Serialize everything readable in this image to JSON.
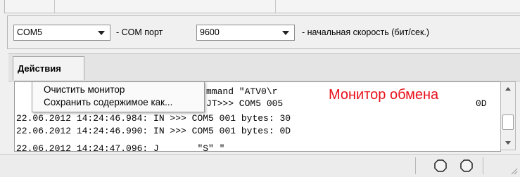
{
  "settings": {
    "port_value": "COM5",
    "port_label": "- COM порт",
    "speed_value": "9600",
    "speed_label": "- начальная скорость (бит/сек.)"
  },
  "tab": {
    "label": "Действия"
  },
  "context_menu": {
    "items": [
      "Очистить монитор",
      "Сохранить содержимое как..."
    ]
  },
  "monitor": {
    "lines": [
      "mmand \"ATV0\\r",
      "JT>>> COM5 005",
      "22.06.2012 14:24:46.984: IN >>> COM5 001 bytes: 30",
      "22.06.2012 14:24:46.990: IN >>> COM5 001 bytes: 0D",
      "22.06.2012 14:24:47.096: J       \"S\" \""
    ],
    "overflow_fragment": "0D"
  },
  "annotation": {
    "text": "Монитор обмена",
    "color": "#e8101a"
  },
  "icons": {
    "combo_arrow": "chevron-down-icon",
    "status": [
      "octagon-icon",
      "octagon-icon"
    ],
    "grip": "resize-grip-icon"
  }
}
